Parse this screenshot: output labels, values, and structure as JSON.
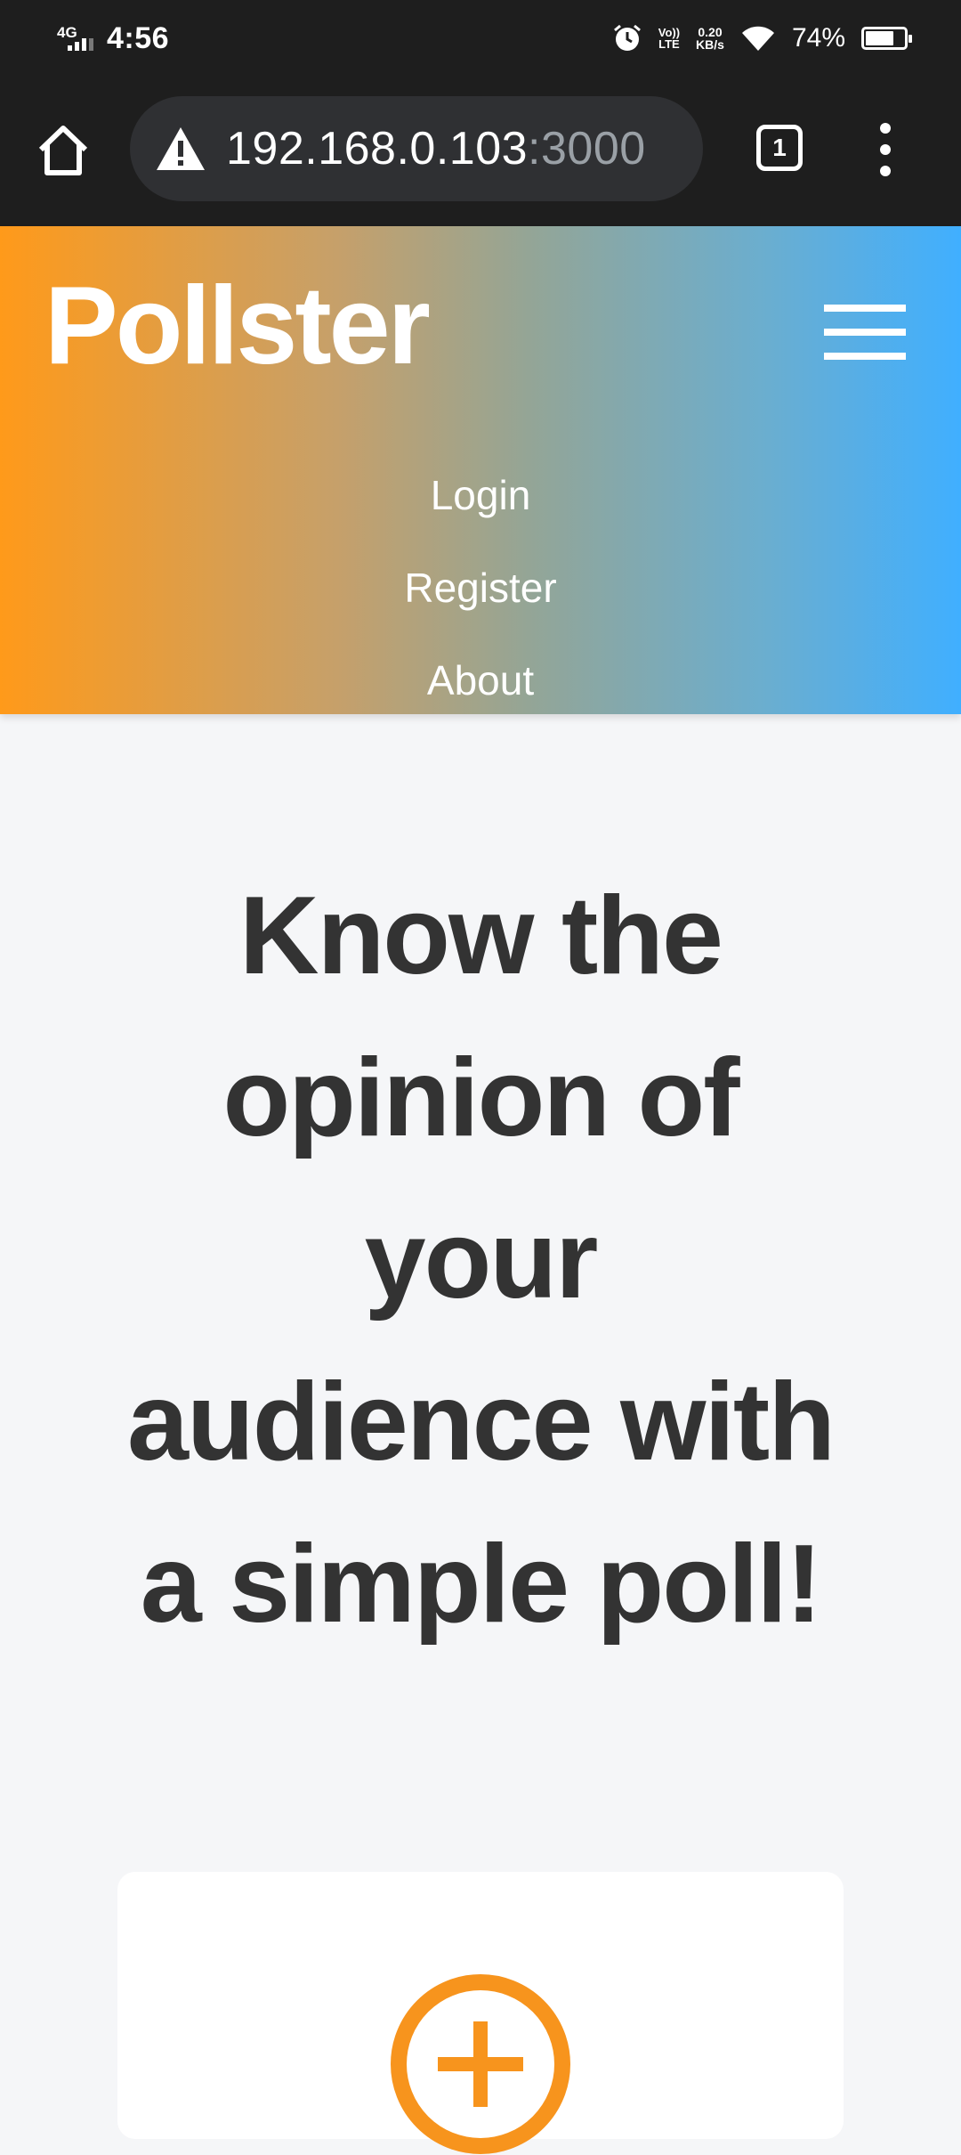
{
  "status_bar": {
    "network": "4G",
    "time": "4:56",
    "volte_line1": "Vo))",
    "volte_line2": "LTE",
    "speed_value": "0.20",
    "speed_unit": "KB/s",
    "battery_percent": "74%",
    "battery_level": 0.74
  },
  "browser": {
    "url_host": "192.168.0.103",
    "url_port": ":3000",
    "tab_count": "1"
  },
  "site": {
    "brand": "Pollster",
    "nav": [
      "Login",
      "Register",
      "About"
    ],
    "hero_title": "Know the opinion of your audience with a simple poll!"
  },
  "colors": {
    "gradient_start": "#ff9a1a",
    "gradient_end": "#40afff",
    "accent_orange": "#f7941d",
    "hero_text": "#333333"
  },
  "icons": {
    "home": "home-icon",
    "warning": "warning-icon",
    "tabs": "tabs-icon",
    "menu": "more-vert-icon",
    "hamburger": "hamburger-icon",
    "add": "plus-circle-icon"
  }
}
